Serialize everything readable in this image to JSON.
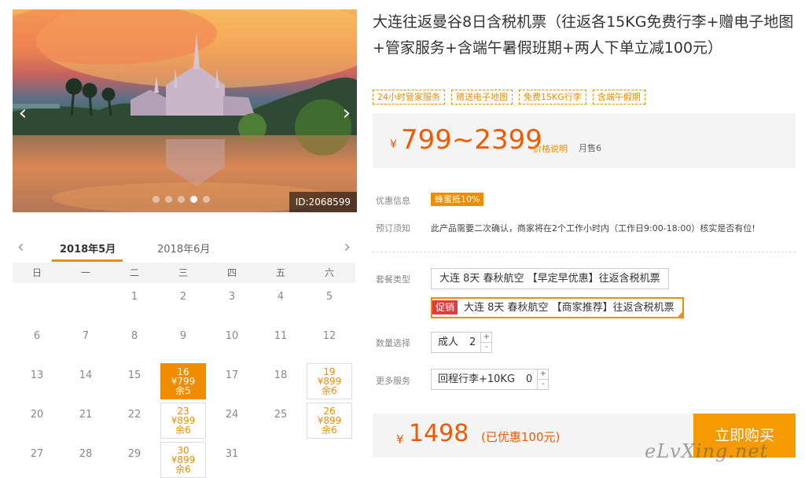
{
  "hero": {
    "id_badge": "ID:2068599",
    "left_arrow": "‹",
    "right_arrow": "›",
    "slide_count": 5,
    "active_slide": 3
  },
  "calendar": {
    "prev": "‹",
    "next": "›",
    "months": [
      "2018年5月",
      "2018年6月"
    ],
    "selected_month": "2018年5月",
    "weekdays": [
      "日",
      "一",
      "二",
      "三",
      "四",
      "五",
      "六"
    ],
    "weeks": [
      [
        {
          "d": ""
        },
        {
          "d": ""
        },
        {
          "d": "1"
        },
        {
          "d": "2"
        },
        {
          "d": "3"
        },
        {
          "d": "4"
        },
        {
          "d": "5"
        }
      ],
      [
        {
          "d": "6"
        },
        {
          "d": "7"
        },
        {
          "d": "8"
        },
        {
          "d": "9"
        },
        {
          "d": "10"
        },
        {
          "d": "11"
        },
        {
          "d": "12"
        }
      ],
      [
        {
          "d": "13"
        },
        {
          "d": "14"
        },
        {
          "d": "15"
        },
        {
          "d": "16",
          "price": "¥799",
          "stock": "余5",
          "state": "selected"
        },
        {
          "d": "17"
        },
        {
          "d": "18"
        },
        {
          "d": "19",
          "price": "¥899",
          "stock": "余6",
          "state": "available"
        }
      ],
      [
        {
          "d": "20"
        },
        {
          "d": "21"
        },
        {
          "d": "22"
        },
        {
          "d": "23",
          "price": "¥899",
          "stock": "余6",
          "state": "available"
        },
        {
          "d": "24"
        },
        {
          "d": "25"
        },
        {
          "d": "26",
          "price": "¥899",
          "stock": "余6",
          "state": "available"
        }
      ],
      [
        {
          "d": "27"
        },
        {
          "d": "28"
        },
        {
          "d": "29"
        },
        {
          "d": "30",
          "price": "¥899",
          "stock": "余6",
          "state": "available"
        },
        {
          "d": "31"
        },
        {
          "d": ""
        },
        {
          "d": ""
        }
      ]
    ]
  },
  "product": {
    "title": "大连往返曼谷8日含税机票（往返各15KG免费行李+赠电子地图+管家服务+含端午暑假班期+两人下单立减100元）",
    "tags": [
      "24小时管家服务",
      "赠送电子地图",
      "免费15KG行李",
      "含端午假期"
    ],
    "price_symbol": "¥",
    "price_range": "799~2399",
    "price_explain": "价格说明",
    "monthly_sales": "月售6"
  },
  "info": {
    "promo_label": "优惠信息",
    "promo_value": "蜂蜜抵10%",
    "notice_label": "预订须知",
    "notice_value": "此产品需要二次确认，商家将在2个工作小时内（工作日9:00-18:00）核实是否有位!"
  },
  "options": {
    "package_label": "套餐类型",
    "packages": [
      {
        "text": "大连 8天 春秋航空 【早定早优惠】往返含税机票",
        "promo": "",
        "selected": false
      },
      {
        "text": "大连 8天 春秋航空 【商家推荐】往返含税机票",
        "promo": "促销",
        "selected": true
      }
    ],
    "quantity_label": "数量选择",
    "quantity_type": "成人",
    "quantity_value": "2",
    "service_label": "更多服务",
    "service_name": "回程行李+10KG",
    "service_value": "0",
    "plus": "+",
    "minus": "-"
  },
  "checkout": {
    "price_symbol": "¥",
    "total": "1498",
    "discount": "(已优惠100元)",
    "buy_label": "立即购买"
  },
  "watermark": "eLvXing.net"
}
